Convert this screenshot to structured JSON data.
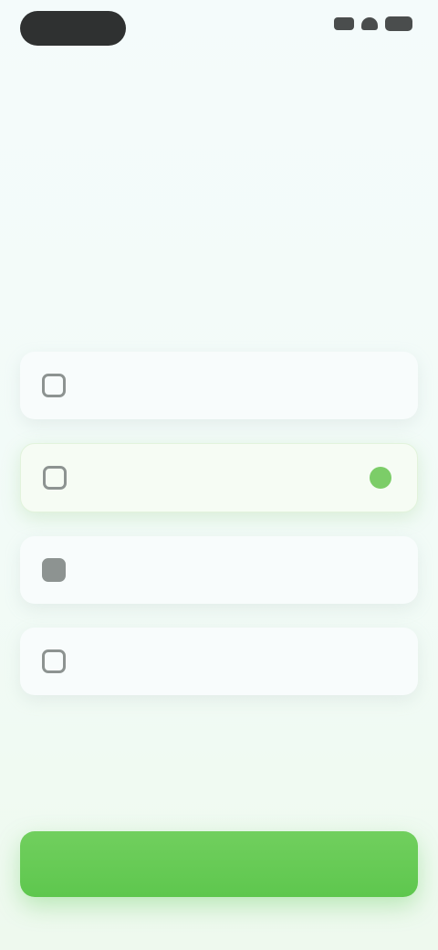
{
  "top_link": {
    "label": ""
  },
  "header": {
    "title": "",
    "subtitle": ""
  },
  "form": {
    "fields": [
      {
        "placeholder": "",
        "value": "",
        "icon": "user-icon"
      },
      {
        "placeholder": "",
        "value": "",
        "icon": "phone-icon",
        "valid": true
      },
      {
        "placeholder": "",
        "value": "",
        "icon": "mail-icon"
      },
      {
        "placeholder": "",
        "value": "",
        "icon": "lock-icon"
      }
    ]
  },
  "submit": {
    "label": ""
  },
  "colors": {
    "accent": "#66c957",
    "background": "#f3fbfb"
  }
}
